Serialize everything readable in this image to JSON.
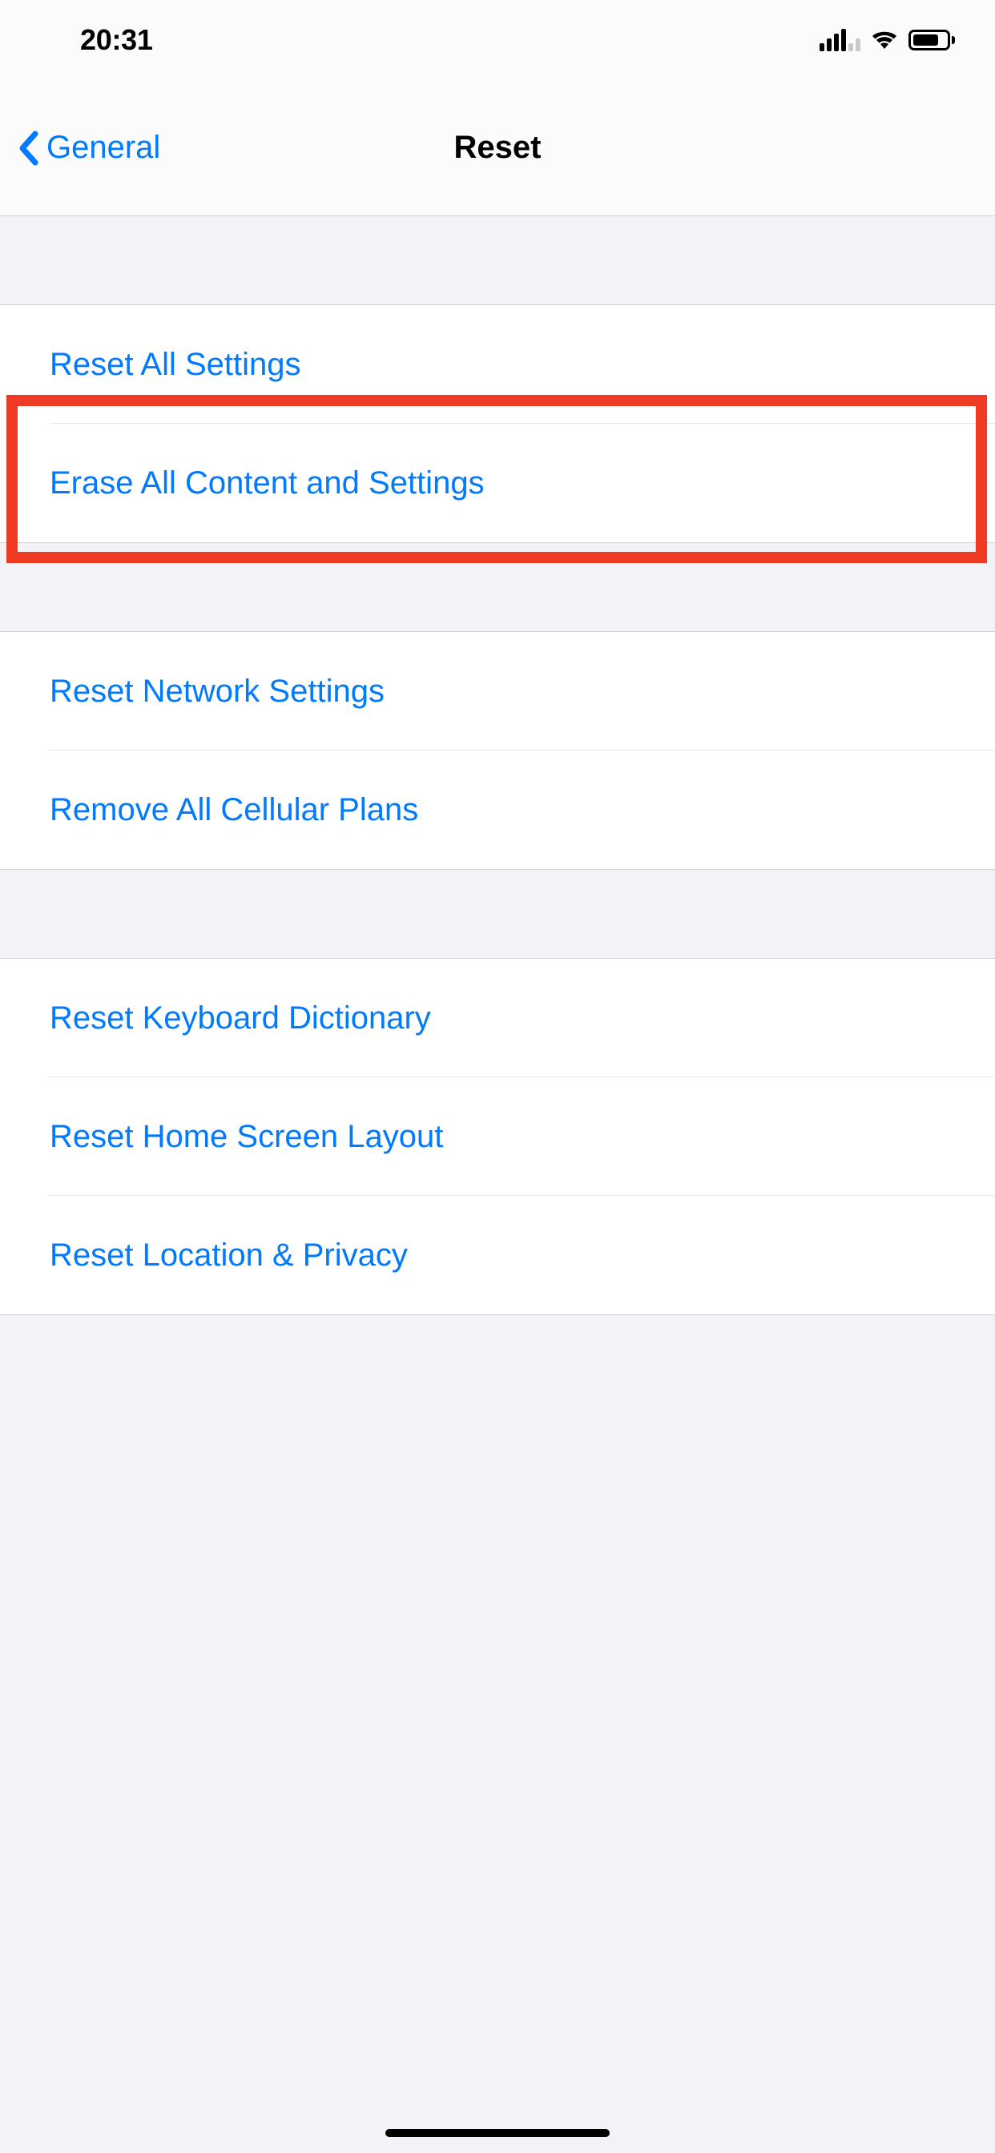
{
  "status": {
    "time": "20:31"
  },
  "nav": {
    "back_label": "General",
    "title": "Reset"
  },
  "groups": [
    {
      "rows": [
        {
          "label": "Reset All Settings"
        },
        {
          "label": "Erase All Content and Settings"
        }
      ]
    },
    {
      "rows": [
        {
          "label": "Reset Network Settings"
        },
        {
          "label": "Remove All Cellular Plans"
        }
      ]
    },
    {
      "rows": [
        {
          "label": "Reset Keyboard Dictionary"
        },
        {
          "label": "Reset Home Screen Layout"
        },
        {
          "label": "Reset Location & Privacy"
        }
      ]
    }
  ]
}
